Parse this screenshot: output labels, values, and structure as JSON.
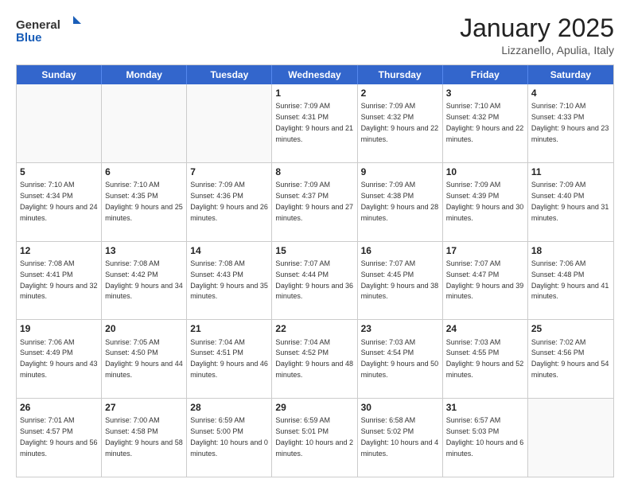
{
  "logo": {
    "general": "General",
    "blue": "Blue"
  },
  "title": "January 2025",
  "location": "Lizzanello, Apulia, Italy",
  "weekdays": [
    "Sunday",
    "Monday",
    "Tuesday",
    "Wednesday",
    "Thursday",
    "Friday",
    "Saturday"
  ],
  "rows": [
    [
      {
        "day": "",
        "info": ""
      },
      {
        "day": "",
        "info": ""
      },
      {
        "day": "",
        "info": ""
      },
      {
        "day": "1",
        "info": "Sunrise: 7:09 AM\nSunset: 4:31 PM\nDaylight: 9 hours and 21 minutes."
      },
      {
        "day": "2",
        "info": "Sunrise: 7:09 AM\nSunset: 4:32 PM\nDaylight: 9 hours and 22 minutes."
      },
      {
        "day": "3",
        "info": "Sunrise: 7:10 AM\nSunset: 4:32 PM\nDaylight: 9 hours and 22 minutes."
      },
      {
        "day": "4",
        "info": "Sunrise: 7:10 AM\nSunset: 4:33 PM\nDaylight: 9 hours and 23 minutes."
      }
    ],
    [
      {
        "day": "5",
        "info": "Sunrise: 7:10 AM\nSunset: 4:34 PM\nDaylight: 9 hours and 24 minutes."
      },
      {
        "day": "6",
        "info": "Sunrise: 7:10 AM\nSunset: 4:35 PM\nDaylight: 9 hours and 25 minutes."
      },
      {
        "day": "7",
        "info": "Sunrise: 7:09 AM\nSunset: 4:36 PM\nDaylight: 9 hours and 26 minutes."
      },
      {
        "day": "8",
        "info": "Sunrise: 7:09 AM\nSunset: 4:37 PM\nDaylight: 9 hours and 27 minutes."
      },
      {
        "day": "9",
        "info": "Sunrise: 7:09 AM\nSunset: 4:38 PM\nDaylight: 9 hours and 28 minutes."
      },
      {
        "day": "10",
        "info": "Sunrise: 7:09 AM\nSunset: 4:39 PM\nDaylight: 9 hours and 30 minutes."
      },
      {
        "day": "11",
        "info": "Sunrise: 7:09 AM\nSunset: 4:40 PM\nDaylight: 9 hours and 31 minutes."
      }
    ],
    [
      {
        "day": "12",
        "info": "Sunrise: 7:08 AM\nSunset: 4:41 PM\nDaylight: 9 hours and 32 minutes."
      },
      {
        "day": "13",
        "info": "Sunrise: 7:08 AM\nSunset: 4:42 PM\nDaylight: 9 hours and 34 minutes."
      },
      {
        "day": "14",
        "info": "Sunrise: 7:08 AM\nSunset: 4:43 PM\nDaylight: 9 hours and 35 minutes."
      },
      {
        "day": "15",
        "info": "Sunrise: 7:07 AM\nSunset: 4:44 PM\nDaylight: 9 hours and 36 minutes."
      },
      {
        "day": "16",
        "info": "Sunrise: 7:07 AM\nSunset: 4:45 PM\nDaylight: 9 hours and 38 minutes."
      },
      {
        "day": "17",
        "info": "Sunrise: 7:07 AM\nSunset: 4:47 PM\nDaylight: 9 hours and 39 minutes."
      },
      {
        "day": "18",
        "info": "Sunrise: 7:06 AM\nSunset: 4:48 PM\nDaylight: 9 hours and 41 minutes."
      }
    ],
    [
      {
        "day": "19",
        "info": "Sunrise: 7:06 AM\nSunset: 4:49 PM\nDaylight: 9 hours and 43 minutes."
      },
      {
        "day": "20",
        "info": "Sunrise: 7:05 AM\nSunset: 4:50 PM\nDaylight: 9 hours and 44 minutes."
      },
      {
        "day": "21",
        "info": "Sunrise: 7:04 AM\nSunset: 4:51 PM\nDaylight: 9 hours and 46 minutes."
      },
      {
        "day": "22",
        "info": "Sunrise: 7:04 AM\nSunset: 4:52 PM\nDaylight: 9 hours and 48 minutes."
      },
      {
        "day": "23",
        "info": "Sunrise: 7:03 AM\nSunset: 4:54 PM\nDaylight: 9 hours and 50 minutes."
      },
      {
        "day": "24",
        "info": "Sunrise: 7:03 AM\nSunset: 4:55 PM\nDaylight: 9 hours and 52 minutes."
      },
      {
        "day": "25",
        "info": "Sunrise: 7:02 AM\nSunset: 4:56 PM\nDaylight: 9 hours and 54 minutes."
      }
    ],
    [
      {
        "day": "26",
        "info": "Sunrise: 7:01 AM\nSunset: 4:57 PM\nDaylight: 9 hours and 56 minutes."
      },
      {
        "day": "27",
        "info": "Sunrise: 7:00 AM\nSunset: 4:58 PM\nDaylight: 9 hours and 58 minutes."
      },
      {
        "day": "28",
        "info": "Sunrise: 6:59 AM\nSunset: 5:00 PM\nDaylight: 10 hours and 0 minutes."
      },
      {
        "day": "29",
        "info": "Sunrise: 6:59 AM\nSunset: 5:01 PM\nDaylight: 10 hours and 2 minutes."
      },
      {
        "day": "30",
        "info": "Sunrise: 6:58 AM\nSunset: 5:02 PM\nDaylight: 10 hours and 4 minutes."
      },
      {
        "day": "31",
        "info": "Sunrise: 6:57 AM\nSunset: 5:03 PM\nDaylight: 10 hours and 6 minutes."
      },
      {
        "day": "",
        "info": ""
      }
    ]
  ]
}
